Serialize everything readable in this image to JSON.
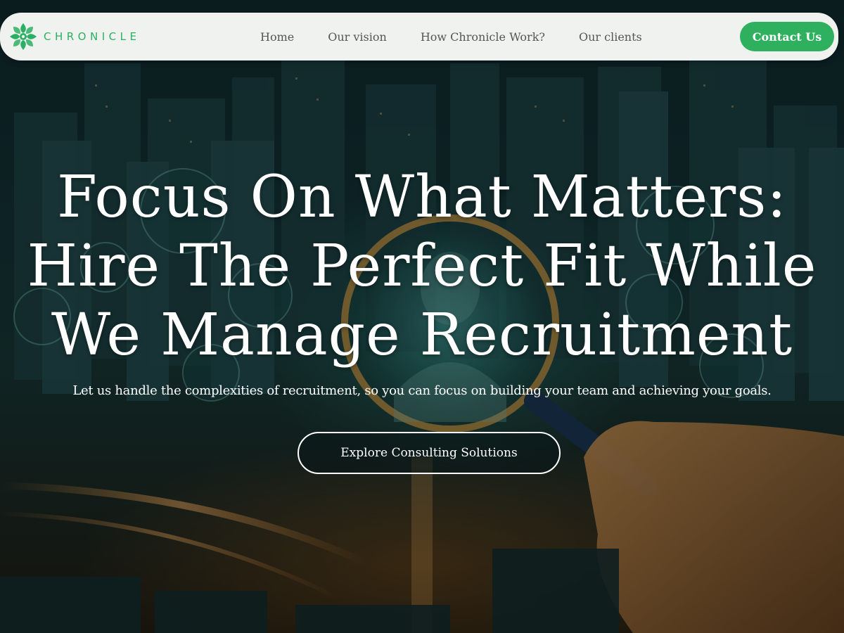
{
  "brand": {
    "name": "CHRONICLE",
    "color": "#2bb063"
  },
  "nav": {
    "items": [
      {
        "label": "Home"
      },
      {
        "label": "Our vision"
      },
      {
        "label": "How Chronicle Work?"
      },
      {
        "label": "Our clients"
      }
    ],
    "contact_label": "Contact Us"
  },
  "hero": {
    "title_lines": [
      "Focus On What Matters:",
      "Hire The Perfect Fit While",
      "We Manage Recruitment"
    ],
    "subtitle": "Let us handle the complexities of recruitment, so you can focus on building your team and achieving your goals.",
    "cta_label": "Explore Consulting Solutions"
  },
  "colors": {
    "accent": "#2fb05f",
    "nav_bg": "#f0f2f0",
    "nav_text": "#555555",
    "hero_text": "#ffffff"
  }
}
